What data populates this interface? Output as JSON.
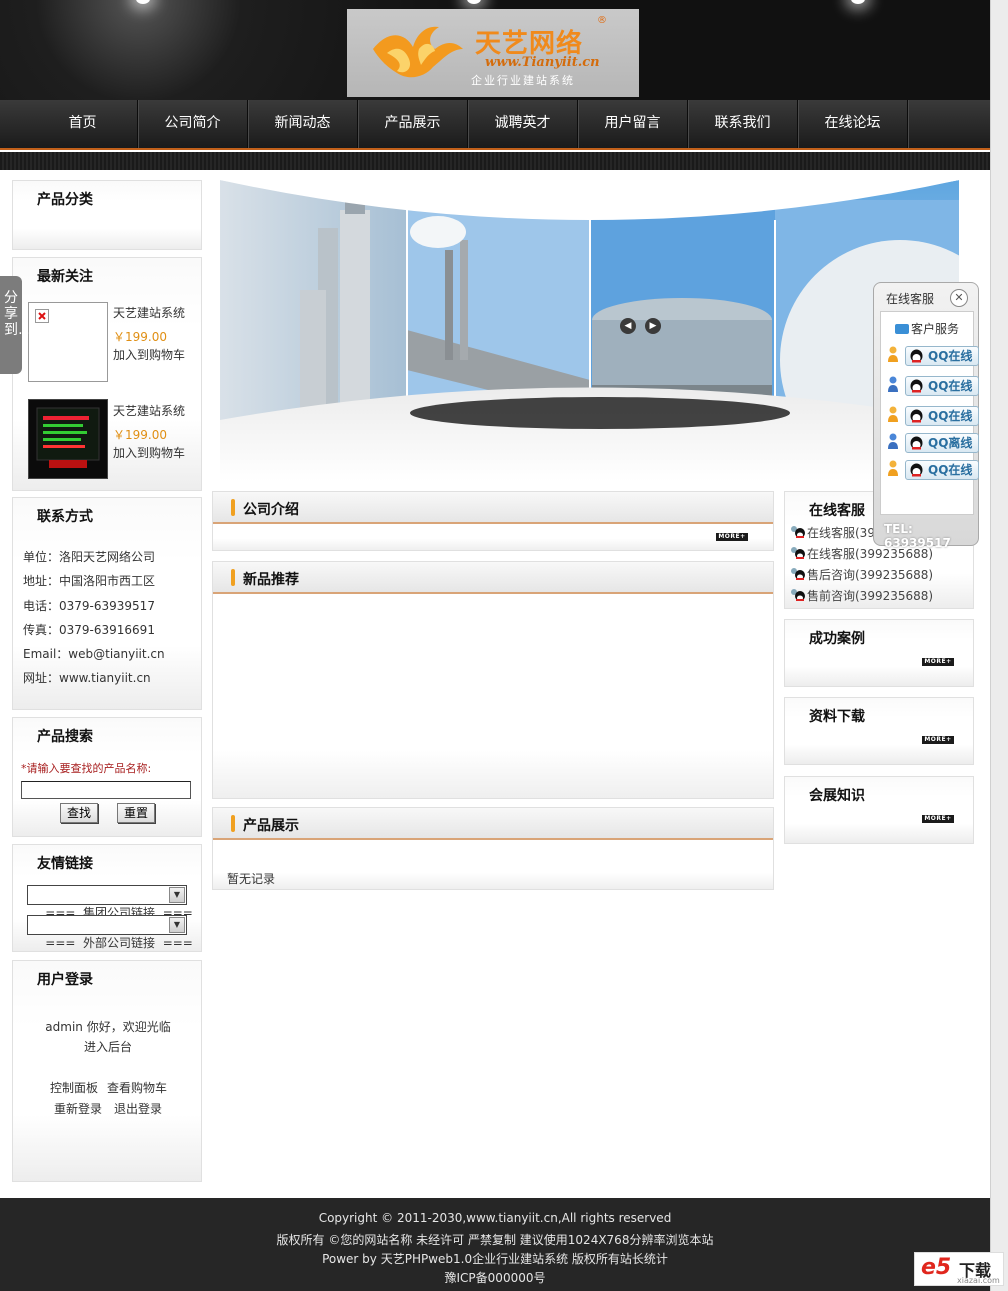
{
  "header": {
    "logo_cn": "天艺网络",
    "logo_reg": "®",
    "logo_url": "www.Tianyiit.cn",
    "logo_slogan": "企业行业建站系统"
  },
  "nav": [
    "首页",
    "公司简介",
    "新闻动态",
    "产品展示",
    "诚聘英才",
    "用户留言",
    "联系我们",
    "在线论坛"
  ],
  "share_tab": "分享到…",
  "left": {
    "categories_title": "产品分类",
    "latest_title": "最新关注",
    "products": [
      {
        "name": "天艺建站系统",
        "price": "￥199.00",
        "cart": "加入到购物车"
      },
      {
        "name": "天艺建站系统",
        "price": "￥199.00",
        "cart": "加入到购物车"
      }
    ],
    "contact_title": "联系方式",
    "contact": [
      "单位：洛阳天艺网络公司",
      "地址：中国洛阳市西工区",
      "电话：0379-63939517",
      "传真：0379-63916691",
      "Email：web@tianyiit.cn",
      "网址：www.tianyiit.cn"
    ],
    "search_title": "产品搜索",
    "search_hint": "*请输入要查找的产品名称:",
    "search_value": "",
    "search_button": "查找",
    "reset_button": "重置",
    "links_title": "友情链接",
    "link_select_1": "===  集团公司链接  ===",
    "link_select_2": "===  外部公司链接  ===",
    "login_title": "用户登录",
    "login_welcome": "admin 你好，欢迎光临",
    "login_admin": "进入后台",
    "login_panel": "控制面板",
    "login_cart": "查看购物车",
    "login_relogin": "重新登录",
    "login_logout": "退出登录"
  },
  "center": {
    "intro_title": "公司介绍",
    "new_title": "新品推荐",
    "show_title": "产品展示",
    "show_empty": "暂无记录",
    "more": "MORE+"
  },
  "right": {
    "service_title": "在线客服",
    "services": [
      "在线客服(399235688)",
      "在线客服(399235688)",
      "售后咨询(399235688)",
      "售前咨询(399235688)"
    ],
    "cases_title": "成功案例",
    "download_title": "资料下载",
    "knowledge_title": "会展知识"
  },
  "float": {
    "title": "在线客服",
    "group": "客户服务",
    "buttons": [
      "QQ在线",
      "QQ在线",
      "QQ在线",
      "QQ离线",
      "QQ在线"
    ],
    "tel": "TEL: 63939517"
  },
  "footer": {
    "line1": "Copyright © 2011-2030,www.tianyiit.cn,All rights reserved",
    "line2": "版权所有 ©您的网站名称 未经许可 严禁复制 建议使用1024X768分辨率浏览本站",
    "line3": "Power by 天艺PHPweb1.0企业行业建站系统 版权所有站长统计",
    "line4": "豫ICP备000000号"
  },
  "watermark": {
    "brand": "e5",
    "text": "下载",
    "url": "xiazai.com"
  },
  "colors": {
    "accent": "#f0a020",
    "price": "#e08f14",
    "nav_bg": "#1b1b1b",
    "footer_bg": "#262626"
  }
}
